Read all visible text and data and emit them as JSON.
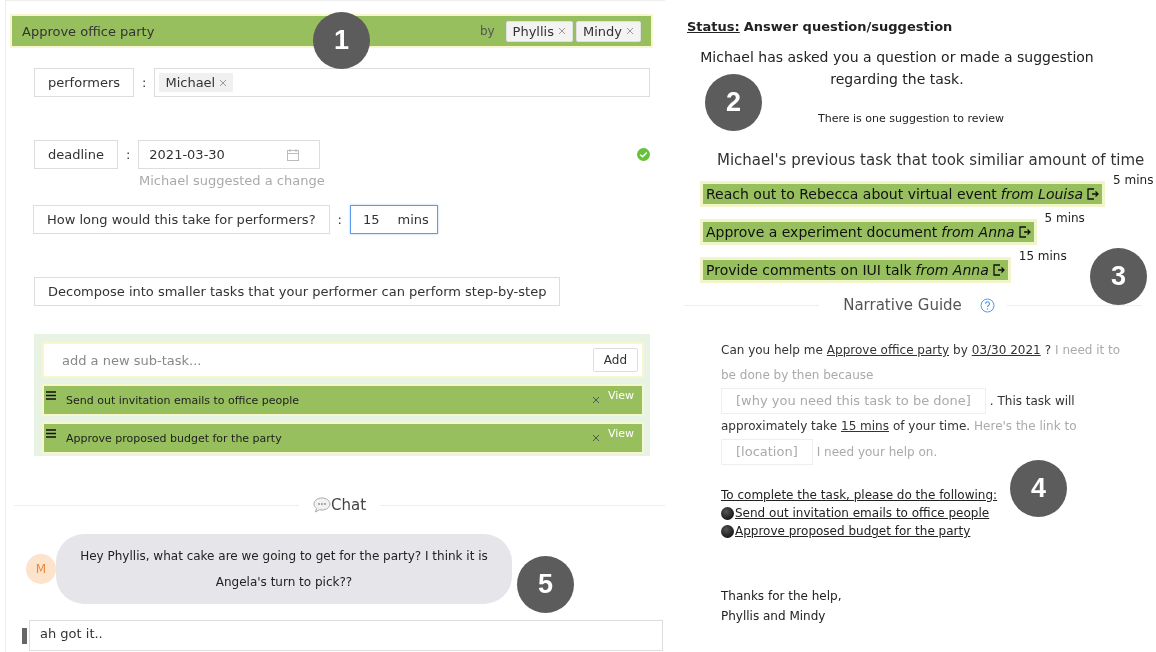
{
  "task": {
    "title": "Approve office party",
    "by_label": "by",
    "requesters": [
      "Phyllis",
      "Mindy"
    ],
    "performers": {
      "label": "performers",
      "separator": ":",
      "tags": [
        "Michael"
      ]
    },
    "deadline": {
      "label": "deadline",
      "separator": ":",
      "value": "2021-03-30",
      "note": "Michael suggested a change",
      "confirmed": true
    },
    "duration": {
      "label": "How long would this take for performers?",
      "separator": ":",
      "value": "15",
      "unit": "mins",
      "focused": true
    },
    "decompose_label": "Decompose into smaller tasks that your performer can perform step-by-step",
    "subtasks": {
      "placeholder": "add a new sub-task...",
      "add_button": "Add",
      "items": [
        {
          "title": "Send out invitation emails to office people",
          "action": "View"
        },
        {
          "title": "Approve proposed budget for the party",
          "action": "View"
        }
      ]
    }
  },
  "chat": {
    "heading": "Chat",
    "messages": [
      {
        "avatar": "M",
        "text": "Hey Phyllis, what cake are we going to get for the party? I think it is Angela's turn to pick??"
      }
    ],
    "input_value": "ah got it.."
  },
  "status": {
    "label": "Status:",
    "value": "Answer question/suggestion",
    "notice": "Michael has asked you a question or made a suggestion regarding the task.",
    "review_note": "There is one suggestion to review"
  },
  "previous_tasks": {
    "heading": "Michael's previous task that took similiar amount of time",
    "items": [
      {
        "title": "Reach out to Rebecca about virtual event",
        "from": "from Louisa",
        "duration": "5 mins"
      },
      {
        "title": "Approve a experiment document",
        "from": "from Anna",
        "duration": "5 mins"
      },
      {
        "title": "Provide comments on IUI talk",
        "from": "from Anna",
        "duration": "15 mins"
      }
    ]
  },
  "narrative": {
    "heading": "Narrative Guide",
    "lines": [
      [
        {
          "kind": "text",
          "text": "Can you help me"
        },
        {
          "kind": "link",
          "text": "Approve office party"
        },
        {
          "kind": "text",
          "text": "by"
        },
        {
          "kind": "link",
          "text": "03/30 2021"
        },
        {
          "kind": "text",
          "text": "?"
        },
        {
          "kind": "hint",
          "text": "I need it to"
        }
      ],
      [
        {
          "kind": "hint",
          "text": "be done by then because"
        }
      ],
      [
        {
          "kind": "field",
          "text": "[why you need this task to be done]"
        },
        {
          "kind": "text",
          "text": ". This task will"
        }
      ],
      [
        {
          "kind": "text",
          "text": "approximately take"
        },
        {
          "kind": "link",
          "text": "15 mins"
        },
        {
          "kind": "text",
          "text": "of your time."
        },
        {
          "kind": "hint",
          "text": "Here's the link to"
        }
      ],
      [
        {
          "kind": "field",
          "text": "[location]"
        },
        {
          "kind": "hint",
          "text": "I need your help on."
        }
      ]
    ],
    "steps_heading": "To complete the task, please do the following:",
    "steps": [
      "Send out invitation emails to office people",
      "Approve proposed budget for the party"
    ],
    "closing": [
      "Thanks for the help,",
      "Phyllis and Mindy"
    ]
  },
  "callouts": [
    "1",
    "2",
    "3",
    "4",
    "5"
  ]
}
